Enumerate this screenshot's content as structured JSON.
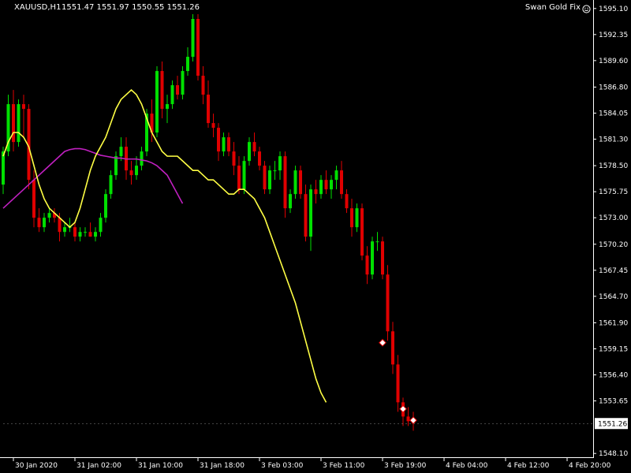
{
  "header": {
    "symbol": "XAUUSD,H1",
    "ohlc": "1551.47 1551.97 1550.55 1551.26",
    "indicator_name": "Swan Gold Fix",
    "smiley_icon": "smiley-icon"
  },
  "colors": {
    "background": "#000000",
    "axis": "#ffffff",
    "bull": "#00e000",
    "bear": "#e00000",
    "fast_ma": "#ffff44",
    "slow_ma": "#c020c0",
    "current_price_box": "#ffffff"
  },
  "chart_data": {
    "type": "candlestick",
    "symbol": "XAUUSD",
    "timeframe": "H1",
    "current_price": "1551.26",
    "y_ticks": [
      "1595.10",
      "1592.35",
      "1589.60",
      "1586.80",
      "1584.05",
      "1581.30",
      "1578.50",
      "1575.75",
      "1573.00",
      "1570.20",
      "1567.45",
      "1564.70",
      "1561.90",
      "1559.15",
      "1556.40",
      "1553.65",
      "1548.10"
    ],
    "x_ticks": [
      {
        "label": "30 Jan 2020",
        "bar": 2
      },
      {
        "label": "31 Jan 02:00",
        "bar": 14
      },
      {
        "label": "31 Jan 10:00",
        "bar": 26
      },
      {
        "label": "31 Jan 18:00",
        "bar": 38
      },
      {
        "label": "3 Feb 03:00",
        "bar": 50
      },
      {
        "label": "3 Feb 11:00",
        "bar": 62
      },
      {
        "label": "3 Feb 19:00",
        "bar": 74
      },
      {
        "label": "4 Feb 04:00",
        "bar": 86
      },
      {
        "label": "4 Feb 12:00",
        "bar": 98
      },
      {
        "label": "4 Feb 20:00",
        "bar": 110
      }
    ],
    "ylim": [
      1547.7,
      1596.0
    ],
    "candles": [
      [
        1576.5,
        1580.5,
        1575.5,
        1580.0
      ],
      [
        1580.0,
        1586.0,
        1579.5,
        1585.0
      ],
      [
        1585.0,
        1586.5,
        1580.0,
        1581.0
      ],
      [
        1581.0,
        1585.5,
        1580.5,
        1585.0
      ],
      [
        1585.0,
        1586.0,
        1581.5,
        1584.5
      ],
      [
        1584.5,
        1585.0,
        1576.0,
        1577.0
      ],
      [
        1577.0,
        1578.0,
        1572.0,
        1573.0
      ],
      [
        1573.0,
        1574.0,
        1571.5,
        1572.0
      ],
      [
        1572.0,
        1573.5,
        1571.5,
        1573.0
      ],
      [
        1573.0,
        1574.0,
        1572.5,
        1573.5
      ],
      [
        1573.5,
        1574.0,
        1572.5,
        1573.0
      ],
      [
        1573.0,
        1573.5,
        1570.5,
        1571.5
      ],
      [
        1571.5,
        1572.5,
        1571.0,
        1572.0
      ],
      [
        1572.0,
        1573.0,
        1571.5,
        1572.0
      ],
      [
        1572.0,
        1572.5,
        1570.5,
        1571.0
      ],
      [
        1571.0,
        1572.0,
        1570.5,
        1571.5
      ],
      [
        1571.5,
        1572.0,
        1571.0,
        1571.5
      ],
      [
        1571.5,
        1572.5,
        1571.0,
        1571.0
      ],
      [
        1571.0,
        1572.0,
        1570.5,
        1571.5
      ],
      [
        1571.5,
        1573.5,
        1571.0,
        1573.0
      ],
      [
        1573.0,
        1576.0,
        1572.5,
        1575.5
      ],
      [
        1575.5,
        1578.0,
        1575.0,
        1577.5
      ],
      [
        1577.5,
        1580.0,
        1577.0,
        1579.5
      ],
      [
        1579.5,
        1581.5,
        1579.0,
        1580.5
      ],
      [
        1580.5,
        1581.5,
        1577.0,
        1578.0
      ],
      [
        1578.0,
        1579.0,
        1576.5,
        1577.5
      ],
      [
        1577.5,
        1579.5,
        1577.0,
        1578.5
      ],
      [
        1578.5,
        1580.5,
        1578.0,
        1580.0
      ],
      [
        1580.0,
        1584.5,
        1579.5,
        1584.0
      ],
      [
        1584.0,
        1585.5,
        1581.0,
        1582.0
      ],
      [
        1582.0,
        1589.0,
        1581.5,
        1588.5
      ],
      [
        1588.5,
        1589.5,
        1583.5,
        1584.5
      ],
      [
        1584.5,
        1586.0,
        1583.0,
        1585.0
      ],
      [
        1585.0,
        1587.5,
        1584.5,
        1587.0
      ],
      [
        1587.0,
        1588.0,
        1585.5,
        1586.0
      ],
      [
        1586.0,
        1589.0,
        1585.5,
        1588.5
      ],
      [
        1588.5,
        1591.0,
        1588.0,
        1590.0
      ],
      [
        1590.0,
        1594.5,
        1589.5,
        1594.0
      ],
      [
        1594.0,
        1594.5,
        1587.5,
        1588.0
      ],
      [
        1588.0,
        1589.0,
        1585.0,
        1586.0
      ],
      [
        1586.0,
        1587.5,
        1582.5,
        1583.0
      ],
      [
        1583.0,
        1584.0,
        1581.5,
        1582.5
      ],
      [
        1582.5,
        1583.0,
        1579.0,
        1580.0
      ],
      [
        1580.0,
        1582.0,
        1579.5,
        1581.5
      ],
      [
        1581.5,
        1582.0,
        1579.5,
        1580.0
      ],
      [
        1580.0,
        1581.0,
        1577.5,
        1578.5
      ],
      [
        1578.5,
        1579.5,
        1575.5,
        1576.0
      ],
      [
        1576.0,
        1579.5,
        1575.5,
        1579.0
      ],
      [
        1579.0,
        1581.5,
        1578.5,
        1581.0
      ],
      [
        1581.0,
        1582.0,
        1579.5,
        1580.0
      ],
      [
        1580.0,
        1580.5,
        1578.0,
        1578.5
      ],
      [
        1578.5,
        1579.0,
        1575.5,
        1576.0
      ],
      [
        1576.0,
        1578.5,
        1575.5,
        1578.0
      ],
      [
        1578.0,
        1579.0,
        1577.0,
        1578.0
      ],
      [
        1578.0,
        1580.0,
        1577.0,
        1579.5
      ],
      [
        1579.5,
        1580.0,
        1573.0,
        1574.0
      ],
      [
        1574.0,
        1576.0,
        1573.5,
        1575.5
      ],
      [
        1575.5,
        1578.5,
        1575.0,
        1578.0
      ],
      [
        1578.0,
        1578.5,
        1575.0,
        1575.5
      ],
      [
        1575.5,
        1576.5,
        1570.5,
        1571.0
      ],
      [
        1571.0,
        1576.5,
        1569.5,
        1576.0
      ],
      [
        1576.0,
        1577.0,
        1574.5,
        1575.5
      ],
      [
        1575.5,
        1577.5,
        1575.0,
        1577.0
      ],
      [
        1577.0,
        1578.0,
        1575.5,
        1576.0
      ],
      [
        1576.0,
        1577.5,
        1575.0,
        1577.0
      ],
      [
        1577.0,
        1578.5,
        1576.0,
        1578.0
      ],
      [
        1578.0,
        1579.0,
        1575.0,
        1575.5
      ],
      [
        1575.5,
        1576.0,
        1573.5,
        1574.0
      ],
      [
        1574.0,
        1575.0,
        1571.0,
        1572.0
      ],
      [
        1572.0,
        1574.5,
        1571.5,
        1574.0
      ],
      [
        1574.0,
        1574.5,
        1568.5,
        1569.0
      ],
      [
        1569.0,
        1570.0,
        1566.0,
        1567.0
      ],
      [
        1567.0,
        1571.0,
        1566.5,
        1570.5
      ],
      [
        1570.5,
        1571.5,
        1569.5,
        1570.5
      ],
      [
        1570.5,
        1571.0,
        1566.5,
        1567.0
      ],
      [
        1567.0,
        1568.0,
        1560.0,
        1561.0
      ],
      [
        1561.0,
        1562.0,
        1556.5,
        1557.5
      ],
      [
        1557.5,
        1558.5,
        1552.5,
        1553.5
      ],
      [
        1553.5,
        1554.0,
        1551.0,
        1552.0
      ],
      [
        1552.0,
        1553.0,
        1551.0,
        1551.5
      ],
      [
        1551.5,
        1552.5,
        1550.5,
        1551.26
      ]
    ],
    "fast_ma": [
      1579.5,
      1581.0,
      1582.0,
      1582.0,
      1581.5,
      1580.5,
      1578.5,
      1576.5,
      1575.0,
      1574.0,
      1573.5,
      1573.0,
      1572.5,
      1572.0,
      1572.5,
      1574.0,
      1576.0,
      1578.0,
      1579.5,
      1580.5,
      1581.5,
      1583.0,
      1584.5,
      1585.5,
      1586.0,
      1586.5,
      1586.0,
      1585.0,
      1583.5,
      1582.0,
      1581.0,
      1580.0,
      1579.5,
      1579.5,
      1579.5,
      1579.0,
      1578.5,
      1578.0,
      1578.0,
      1577.5,
      1577.0,
      1577.0,
      1576.5,
      1576.0,
      1575.5,
      1575.5,
      1576.0,
      1576.0,
      1575.5,
      1575.0,
      1574.0,
      1573.0,
      1571.5,
      1570.0,
      1568.5,
      1567.0,
      1565.5,
      1564.0,
      1562.0,
      1560.0,
      1558.0,
      1556.0,
      1554.5,
      1553.5
    ],
    "slow_ma": [
      1574.0,
      1574.5,
      1575.0,
      1575.5,
      1576.0,
      1576.5,
      1577.0,
      1577.5,
      1578.0,
      1578.5,
      1579.0,
      1579.5,
      1580.0,
      1580.2,
      1580.3,
      1580.3,
      1580.2,
      1580.0,
      1579.8,
      1579.6,
      1579.5,
      1579.4,
      1579.3,
      1579.3,
      1579.2,
      1579.2,
      1579.2,
      1579.1,
      1579.0,
      1578.8,
      1578.5,
      1578.0,
      1577.5,
      1576.5,
      1575.5,
      1574.5
    ],
    "markers": [
      {
        "bar": 74,
        "price": 1559.8
      },
      {
        "bar": 78,
        "price": 1552.8
      },
      {
        "bar": 80,
        "price": 1551.6
      }
    ]
  }
}
